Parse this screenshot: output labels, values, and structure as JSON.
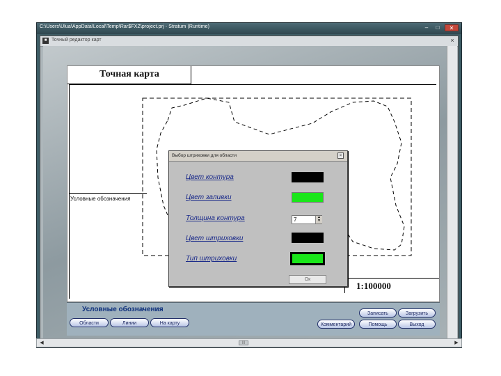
{
  "window": {
    "title": "C:\\Users\\Ulua\\AppData\\Local\\Temp\\Rar$FXZ\\project.prj - Stratum (Runtime)",
    "inner_title": "Точный редактор карт"
  },
  "map": {
    "title": "Точная карта",
    "legend_label": "Условные обозначения",
    "scale": "1:100000"
  },
  "bottom_panel": {
    "title": "Условные обозначения",
    "buttons": {
      "oblasti": "Области",
      "linii": "Линии",
      "na_kartu": "На карту",
      "zapisat": "Записать",
      "zagruzit": "Загрузить",
      "kommentarii": "Комментарий",
      "pomosch": "Помощь",
      "vyhod": "Выход"
    }
  },
  "dialog": {
    "title": "Выбор штриховки для области",
    "labels": {
      "contour_color": "Цвет контура",
      "fill_color": "Цвет заливки",
      "contour_thickness": "Толщина контура",
      "hatch_color": "Цвет штриховки",
      "hatch_type": "Тип штриховки"
    },
    "thickness_value": "7",
    "ok_label": "Ок",
    "colors": {
      "contour": "#000000",
      "fill": "#19e619",
      "hatch": "#000000"
    }
  },
  "icons": [
    "minimize-icon",
    "maximize-icon",
    "close-icon",
    "app-icon",
    "spinner-arrows-icon",
    "scroll-left-icon",
    "scroll-right-icon"
  ]
}
